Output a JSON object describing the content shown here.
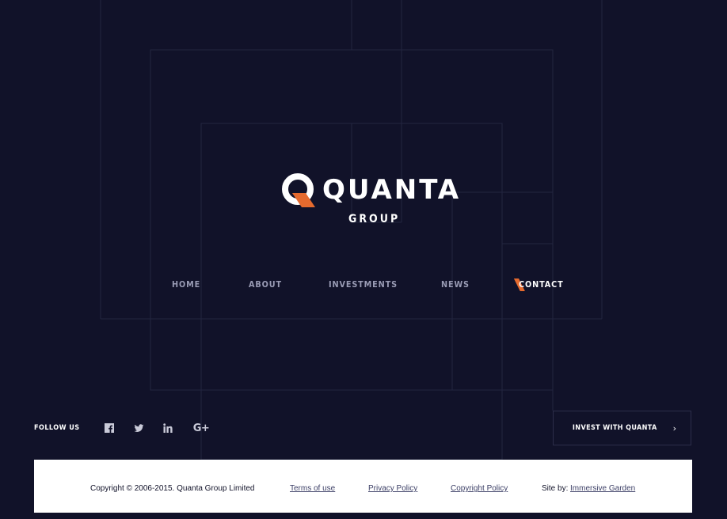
{
  "brand": {
    "word": "QUANTA",
    "sub": "GROUP",
    "colors": {
      "background": "#111229",
      "accent": "#e56a2e",
      "text": "#ffffff",
      "nav_inactive": "#9a9cb5",
      "line": "#25273f"
    }
  },
  "nav": {
    "items": [
      {
        "label": "HOME",
        "active": false
      },
      {
        "label": "ABOUT",
        "active": false
      },
      {
        "label": "INVESTMENTS",
        "active": false
      },
      {
        "label": "NEWS",
        "active": false
      },
      {
        "label": "CONTACT",
        "active": true
      }
    ]
  },
  "social": {
    "label": "FOLLOW US",
    "icons": [
      "facebook-icon",
      "twitter-icon",
      "linkedin-icon",
      "google-plus-icon"
    ],
    "gplus_text": "G+"
  },
  "cta": {
    "label": "INVEST WITH QUANTA",
    "icon": "chevron-right-icon",
    "chevron": "›"
  },
  "footer": {
    "copyright": "Copyright © 2006-2015. Quanta Group Limited",
    "terms": "Terms of use",
    "privacy": "Privacy Policy",
    "copyright_policy": "Copyright Policy",
    "site_by_label": "Site by:",
    "site_by_link": "Immersive Garden"
  }
}
